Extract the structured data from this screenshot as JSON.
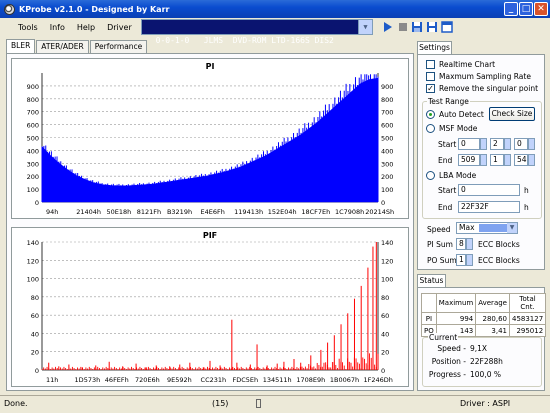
{
  "window": {
    "title": "KProbe v2.1.0 - Designed by Karr"
  },
  "menu": [
    "Tools",
    "Info",
    "Help",
    "Driver"
  ],
  "drive": {
    "selected": "0-0-1-0   JLMS  DVD-ROM LTD-166S DIS2"
  },
  "toolbar": {
    "play": "play-icon",
    "stop": "stop-icon",
    "save": "save-icon",
    "save_as": "save-as-icon",
    "settings": "window-icon"
  },
  "tabs": [
    "BLER",
    "ATER/ADER",
    "Performance"
  ],
  "chart_data": [
    {
      "type": "area",
      "title": "PI",
      "ylim": [
        0,
        1000
      ],
      "yticks": [
        0,
        100,
        200,
        300,
        400,
        500,
        600,
        700,
        800,
        900
      ],
      "xticks": [
        "94h",
        "21404h",
        "50E18h",
        "8121Fh",
        "B3219h",
        "E4E6Fh",
        "119413h",
        "152E04h",
        "18CF7Eh",
        "1C7908h",
        "20214Sh"
      ],
      "x_positions": [
        0,
        0.09,
        0.18,
        0.27,
        0.36,
        0.46,
        0.56,
        0.66,
        0.76,
        0.86,
        0.95
      ],
      "values": [
        430,
        360,
        300,
        250,
        205,
        175,
        150,
        135,
        128,
        125,
        126,
        130,
        135,
        140,
        150,
        160,
        170,
        180,
        190,
        200,
        215,
        230,
        250,
        270,
        300,
        330,
        360,
        400,
        440,
        480,
        520,
        570,
        620,
        680,
        740,
        800,
        860,
        920,
        950,
        960
      ],
      "color": "#0000ff",
      "grid": true
    },
    {
      "type": "bar",
      "title": "PIF",
      "ylim": [
        0,
        140
      ],
      "yticks": [
        0,
        20,
        40,
        60,
        80,
        100,
        120,
        140
      ],
      "xticks": [
        "11h",
        "1D573h",
        "46FEFh",
        "720E6h",
        "9E592h",
        "CC231h",
        "FDC5Eh",
        "134511h",
        "1708E9h",
        "1B0067h",
        "1F246Dh"
      ],
      "x_positions": [
        0,
        0.085,
        0.175,
        0.265,
        0.36,
        0.46,
        0.555,
        0.645,
        0.745,
        0.845,
        0.945
      ],
      "spikes": [
        [
          0.02,
          8
        ],
        [
          0.05,
          4
        ],
        [
          0.08,
          6
        ],
        [
          0.12,
          3
        ],
        [
          0.16,
          5
        ],
        [
          0.2,
          9
        ],
        [
          0.24,
          4
        ],
        [
          0.28,
          7
        ],
        [
          0.31,
          3
        ],
        [
          0.34,
          5
        ],
        [
          0.38,
          4
        ],
        [
          0.41,
          6
        ],
        [
          0.44,
          8
        ],
        [
          0.48,
          3
        ],
        [
          0.5,
          10
        ],
        [
          0.53,
          5
        ],
        [
          0.565,
          55
        ],
        [
          0.58,
          8
        ],
        [
          0.62,
          6
        ],
        [
          0.64,
          28
        ],
        [
          0.67,
          5
        ],
        [
          0.7,
          7
        ],
        [
          0.72,
          9
        ],
        [
          0.75,
          12
        ],
        [
          0.77,
          8
        ],
        [
          0.8,
          16
        ],
        [
          0.83,
          22
        ],
        [
          0.85,
          30
        ],
        [
          0.87,
          38
        ],
        [
          0.89,
          50
        ],
        [
          0.91,
          62
        ],
        [
          0.93,
          78
        ],
        [
          0.95,
          92
        ],
        [
          0.97,
          112
        ],
        [
          0.985,
          135
        ],
        [
          0.995,
          143
        ]
      ],
      "color": "#ff0000",
      "grid": true
    }
  ],
  "settings": {
    "tab": "Settings",
    "realtime_chart": "Realtime Chart",
    "max_sampling": "Maxmum Sampling Rate",
    "remove_singular": "Remove the singular point",
    "test_range": "Test Range",
    "auto_detect": "Auto Detect",
    "check_size": "Check Size",
    "msf_mode": "MSF Mode",
    "start": "Start",
    "end": "End",
    "msf_start": [
      "0",
      "2",
      "0"
    ],
    "msf_end": [
      "509",
      "1",
      "54"
    ],
    "lba_mode": "LBA Mode",
    "lba_start": "0",
    "lba_end": "22F32F",
    "h": "h",
    "speed": "Speed",
    "speed_value": "Max",
    "pi_sum": "PI Sum",
    "pi_sum_value": "8",
    "po_sum": "PO Sum",
    "po_sum_value": "1",
    "ecc_blocks": "ECC Blocks"
  },
  "status": {
    "tab": "Status",
    "headers": [
      "Maximum",
      "Average",
      "Total Cnt."
    ],
    "rows": [
      {
        "label": "PI",
        "max": "994",
        "avg": "280,60",
        "total": "4583127"
      },
      {
        "label": "PO",
        "max": "143",
        "avg": "3,41",
        "total": "295012"
      }
    ],
    "current": "Current",
    "speed_label": "Speed -",
    "speed_value": "9,1X",
    "position_label": "Position -",
    "position_value": "22F288h",
    "progress_label": "Progress -",
    "progress_value": "100,0 %"
  },
  "statusbar": {
    "left": "Done.",
    "middle": "(15)",
    "right": "Driver : ASPI"
  }
}
